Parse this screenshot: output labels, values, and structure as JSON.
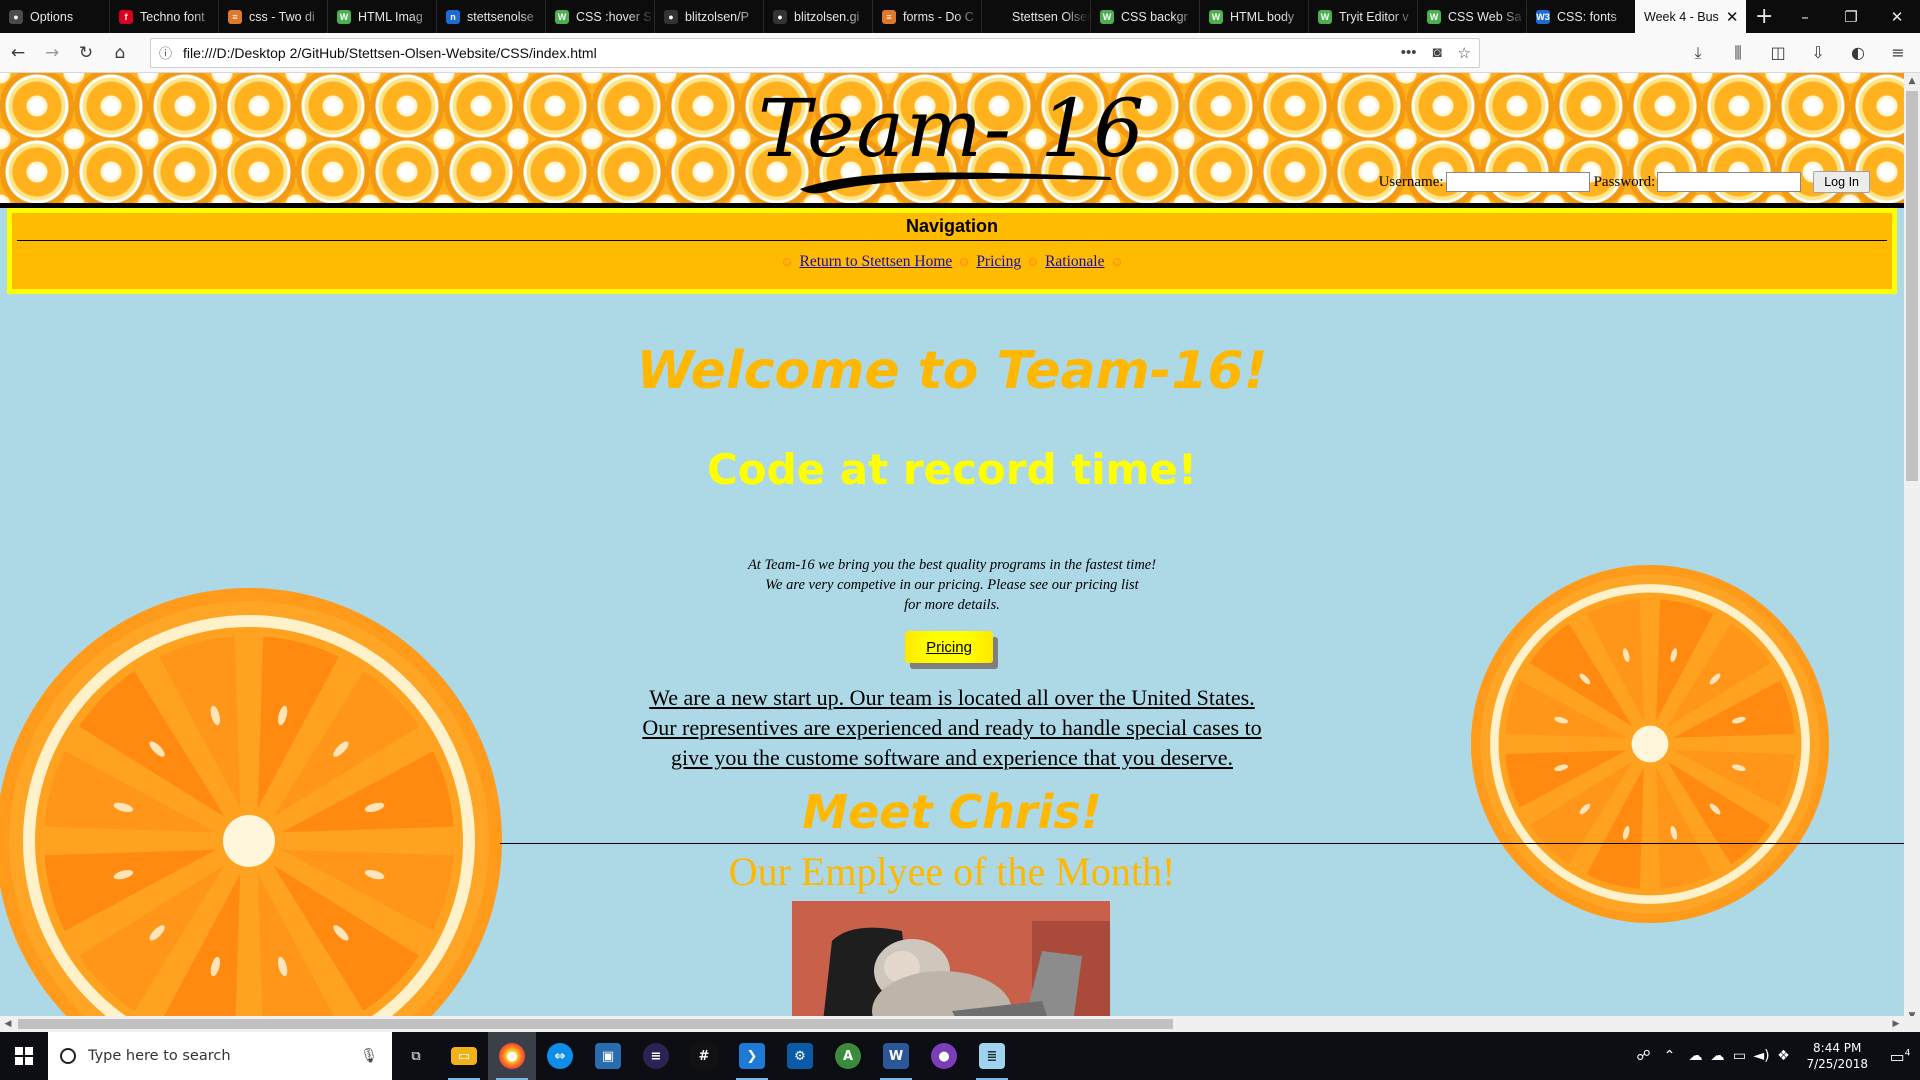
{
  "browser": {
    "tabs": [
      {
        "label": "Options",
        "fav": "#4a4a4f",
        "glyph": "●"
      },
      {
        "label": "Techno font",
        "fav": "#d70022",
        "glyph": "f"
      },
      {
        "label": "css - Two di",
        "fav": "#e07a2a",
        "glyph": "≡"
      },
      {
        "label": "HTML Imag",
        "fav": "#4caf50",
        "glyph": "W"
      },
      {
        "label": "stettsenolse",
        "fav": "#1e6bd6",
        "glyph": "n"
      },
      {
        "label": "CSS :hover S",
        "fav": "#4caf50",
        "glyph": "W"
      },
      {
        "label": "blitzolsen/P",
        "fav": "#333",
        "glyph": "●"
      },
      {
        "label": "blitzolsen.gi",
        "fav": "#333",
        "glyph": "●"
      },
      {
        "label": "forms - Do C",
        "fav": "#e07a2a",
        "glyph": "≡"
      },
      {
        "label": "Stettsen Olsen -",
        "fav": "#0c0c0d",
        "glyph": ""
      },
      {
        "label": "CSS backgr",
        "fav": "#4caf50",
        "glyph": "W"
      },
      {
        "label": "HTML body",
        "fav": "#4caf50",
        "glyph": "W"
      },
      {
        "label": "Tryit Editor v",
        "fav": "#4caf50",
        "glyph": "W"
      },
      {
        "label": "CSS Web Sa",
        "fav": "#4caf50",
        "glyph": "W"
      },
      {
        "label": "CSS: fonts",
        "fav": "#1e6bd6",
        "glyph": "W3"
      }
    ],
    "active_tab": "Week 4 - Bus",
    "url": "file:///D:/Desktop 2/GitHub/Stettsen-Olsen-Website/CSS/index.html"
  },
  "page": {
    "logo": "Team- 16",
    "login": {
      "username_label": "Username:",
      "password_label": "Password:",
      "button": "Log In"
    },
    "nav": {
      "heading": "Navigation",
      "links": [
        "Return to Stettsen Home",
        "Pricing",
        "Rationale"
      ]
    },
    "welcome": "Welcome to Team-16!",
    "tagline": "Code at record time!",
    "intro": [
      "At Team-16 we bring you the best quality programs in the fastest time!",
      "We are very competive in our pricing. Please see our pricing list",
      "for more details."
    ],
    "pricing_button": "Pricing",
    "about": [
      "We are a new start up. Our team is located all over the United States.",
      "Our representives are experienced and ready to handle special cases to",
      "give you the custome software and experience that you deserve."
    ],
    "meet": "Meet Chris!",
    "employee": "Our Emplyee of the Month!"
  },
  "taskbar": {
    "search_placeholder": "Type here to search",
    "time": "8:44 PM",
    "date": "7/25/2018",
    "notifications": "4"
  },
  "colors": {
    "page_bg": "#add8e6",
    "nav_bg": "#ffbb00",
    "nav_border": "#ffff00",
    "heading_orange": "#ffb700",
    "tagline_yellow": "#ffff00"
  }
}
